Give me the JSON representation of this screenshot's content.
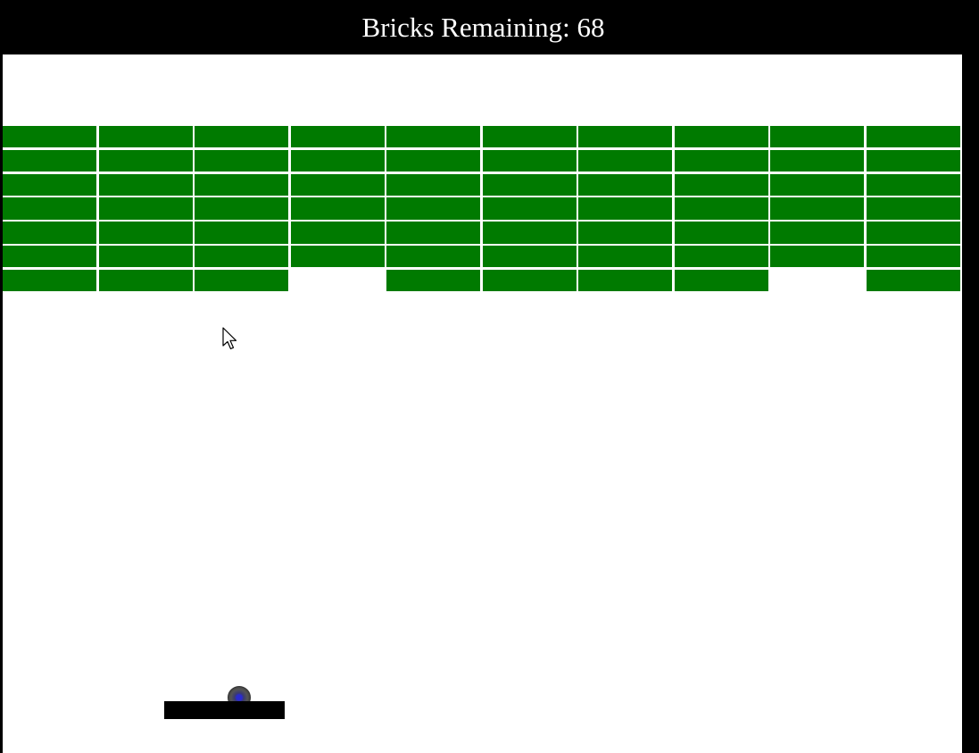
{
  "header": {
    "label": "Bricks Remaining:",
    "count": "68"
  },
  "colors": {
    "frame": "#000000",
    "field": "#ffffff",
    "brick": "#007a00",
    "paddle": "#000000",
    "ball_outer": "#555555",
    "ball_core": "#2a2ad0"
  },
  "bricks": {
    "columns": 10,
    "rows": 7,
    "present": [
      [
        1,
        1,
        1,
        1,
        1,
        1,
        1,
        1,
        1,
        1
      ],
      [
        1,
        1,
        1,
        1,
        1,
        1,
        1,
        1,
        1,
        1
      ],
      [
        1,
        1,
        1,
        1,
        1,
        1,
        1,
        1,
        1,
        1
      ],
      [
        1,
        1,
        1,
        1,
        1,
        1,
        1,
        1,
        1,
        1
      ],
      [
        1,
        1,
        1,
        1,
        1,
        1,
        1,
        1,
        1,
        1
      ],
      [
        1,
        1,
        1,
        1,
        1,
        1,
        1,
        1,
        1,
        1
      ],
      [
        1,
        1,
        1,
        0,
        1,
        1,
        1,
        1,
        0,
        1
      ]
    ]
  },
  "icons": {
    "cursor": "arrow-cursor-icon",
    "ball": "ball-icon"
  }
}
